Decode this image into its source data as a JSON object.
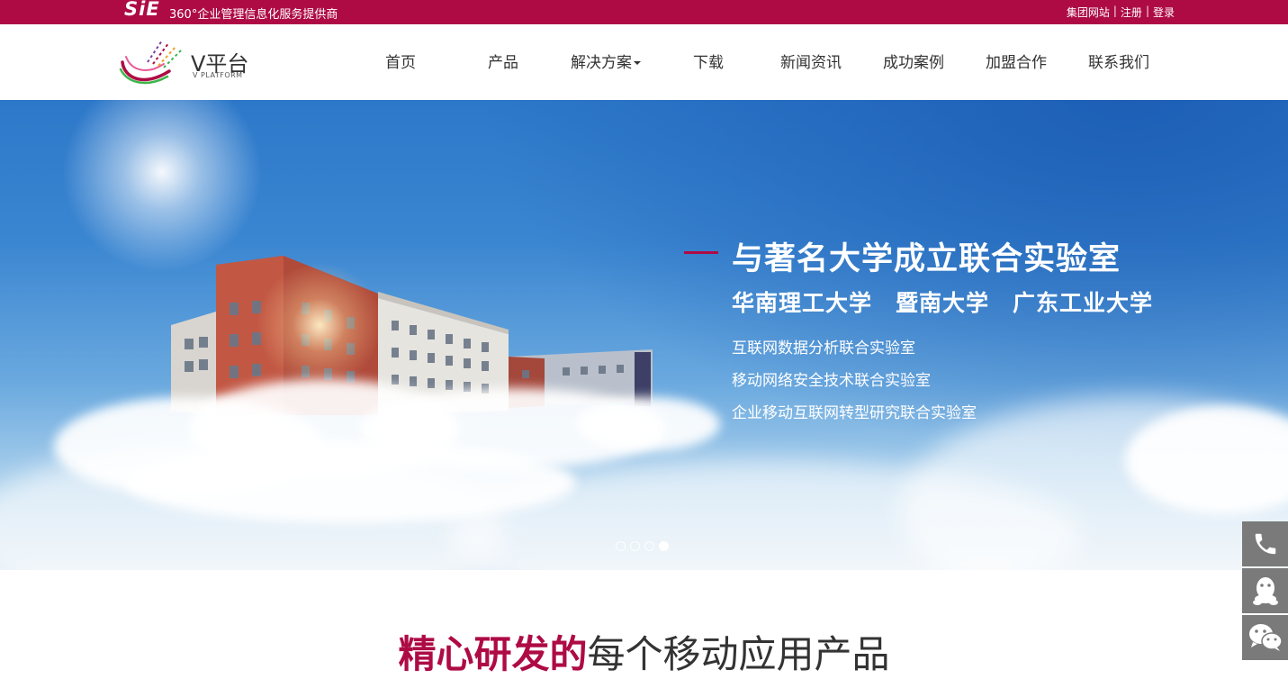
{
  "topbar": {
    "brand": "SiE",
    "tagline": "360°企业管理信息化服务提供商",
    "links": [
      "集团网站",
      "注册",
      "登录"
    ],
    "separator": "|",
    "bg_color": "#ae0b45"
  },
  "header": {
    "logo_text": "V平台",
    "logo_sub": "V PLATFORM",
    "nav": [
      {
        "label": "首页"
      },
      {
        "label": "产品"
      },
      {
        "label": "解决方案",
        "has_dropdown": true
      },
      {
        "label": "下载"
      },
      {
        "label": "新闻资讯"
      },
      {
        "label": "成功案例"
      },
      {
        "label": "加盟合作"
      },
      {
        "label": "联系我们"
      }
    ]
  },
  "banner": {
    "headline": "与著名大学成立联合实验室",
    "universities": "华南理工大学　暨南大学　广东工业大学",
    "labs": [
      "互联网数据分析联合实验室",
      "移动网络安全技术联合实验室",
      "企业移动互联网转型研究联合实验室"
    ],
    "slides_total": 4,
    "active_slide": 4,
    "accent_color": "#ae0b45"
  },
  "floating_contacts": [
    {
      "icon": "phone-icon"
    },
    {
      "icon": "qq-icon"
    },
    {
      "icon": "wechat-icon"
    }
  ],
  "section": {
    "title_highlight": "精心研发的",
    "title_rest": "每个移动应用产品"
  }
}
